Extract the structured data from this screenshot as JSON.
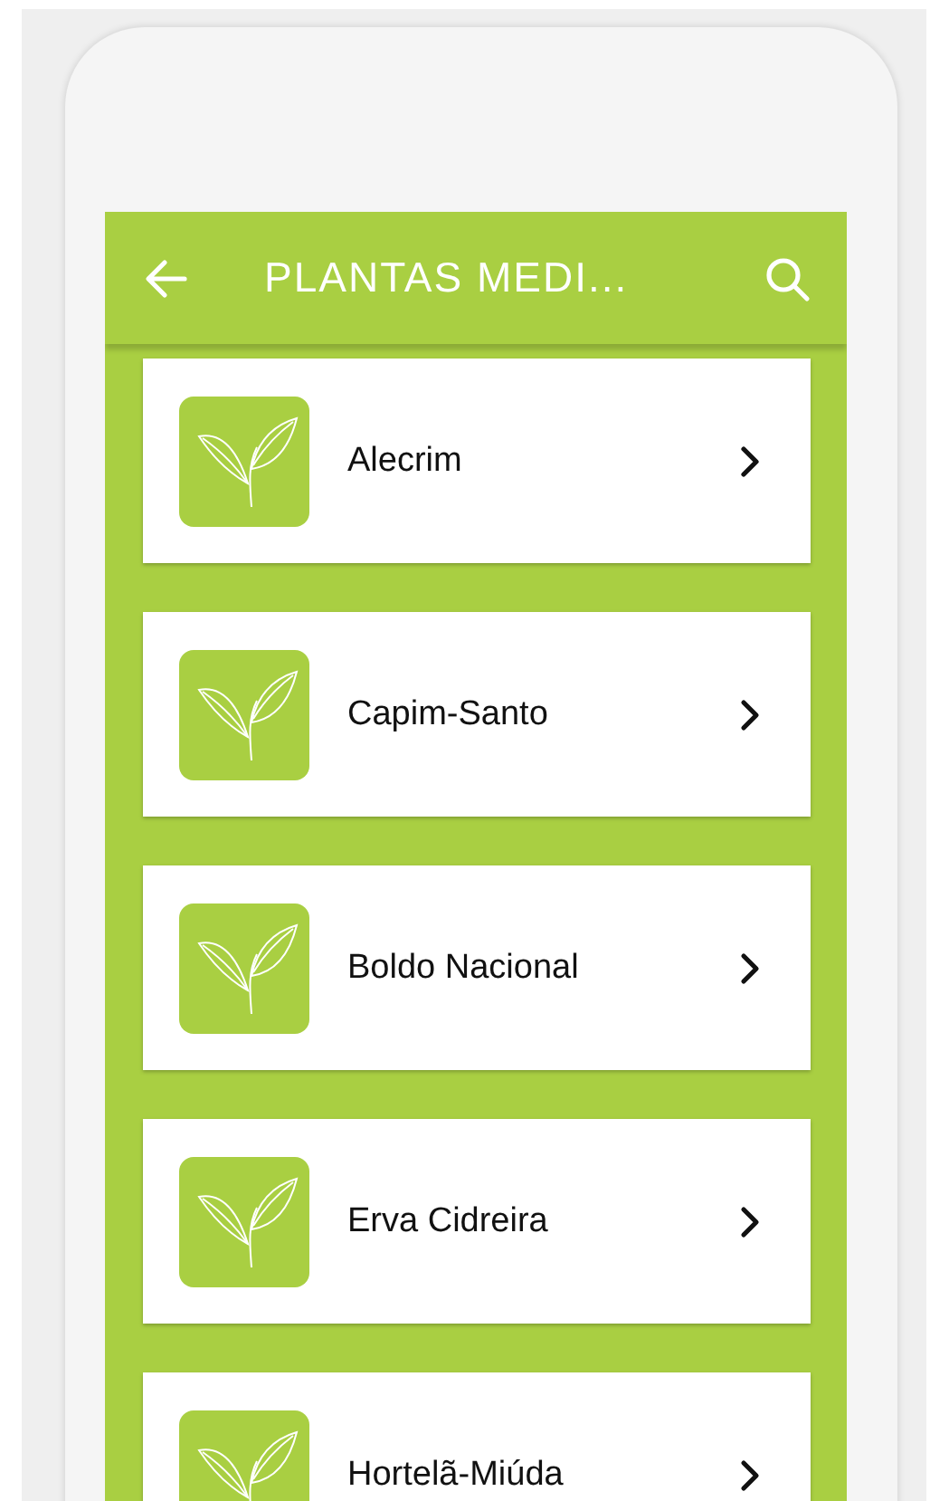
{
  "header": {
    "title": "PLANTAS MEDI..."
  },
  "plants": [
    {
      "name": "Alecrim"
    },
    {
      "name": "Capim-Santo"
    },
    {
      "name": "Boldo Nacional"
    },
    {
      "name": "Erva Cidreira"
    },
    {
      "name": "Hortelã-Miúda"
    }
  ]
}
